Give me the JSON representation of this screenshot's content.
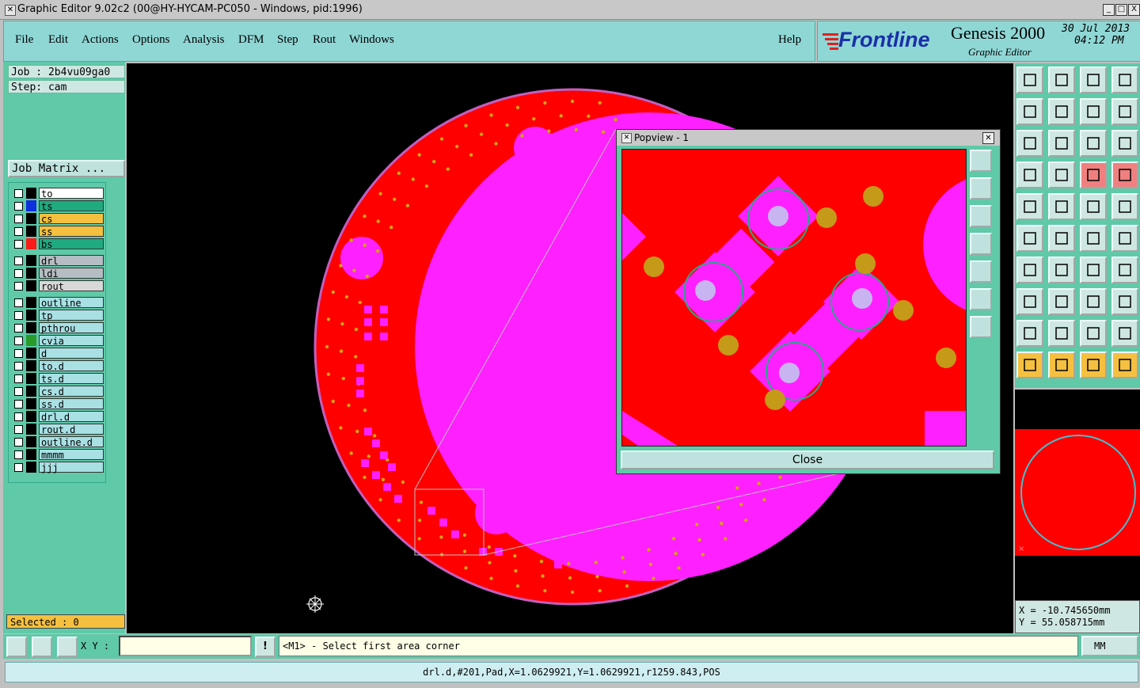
{
  "window": {
    "title": "Graphic Editor 9.02c2 (00@HY-HYCAM-PC050 - Windows, pid:1996)",
    "controls": [
      "_",
      "□",
      "X"
    ]
  },
  "menu": {
    "items": [
      "File",
      "Edit",
      "Actions",
      "Options",
      "Analysis",
      "DFM",
      "Step",
      "Rout",
      "Windows"
    ],
    "help": "Help"
  },
  "brand": {
    "logo": "Frontline",
    "product": "Genesis 2000",
    "subtitle": "Graphic Editor",
    "date": "30 Jul 2013",
    "time": "04:12 PM"
  },
  "job": {
    "job_label": "Job : 2b4vu09ga0",
    "step_label": "Step: cam",
    "matrix_button": "Job Matrix ..."
  },
  "layers": [
    {
      "name": "to",
      "bg": "#ffffff",
      "swatch": "#000000"
    },
    {
      "name": "ts",
      "bg": "#1faa80",
      "swatch": "#1030e0"
    },
    {
      "name": "cs",
      "bg": "#f5c040",
      "swatch": "#000000"
    },
    {
      "name": "ss",
      "bg": "#f5c040",
      "swatch": "#000000"
    },
    {
      "name": "bs",
      "bg": "#1faa80",
      "swatch": "#ff1a1a"
    },
    {
      "name": "drl",
      "bg": "#b5bcc2",
      "swatch": "#000000"
    },
    {
      "name": "ldi",
      "bg": "#b5bcc2",
      "swatch": "#000000"
    },
    {
      "name": "rout",
      "bg": "#d8d8d8",
      "swatch": "#000000"
    },
    {
      "name": "outline",
      "bg": "#a8e0e4",
      "swatch": "#000000"
    },
    {
      "name": "tp",
      "bg": "#a8e0e4",
      "swatch": "#000000"
    },
    {
      "name": "pthrou",
      "bg": "#a8e0e4",
      "swatch": "#000000"
    },
    {
      "name": "cvia",
      "bg": "#a8e0e4",
      "swatch": "#2a9a2a"
    },
    {
      "name": "d",
      "bg": "#a8e0e4",
      "swatch": "#000000"
    },
    {
      "name": "to.d",
      "bg": "#a8e0e4",
      "swatch": "#000000"
    },
    {
      "name": "ts.d",
      "bg": "#a8e0e4",
      "swatch": "#000000"
    },
    {
      "name": "cs.d",
      "bg": "#a8e0e4",
      "swatch": "#000000"
    },
    {
      "name": "ss.d",
      "bg": "#a8e0e4",
      "swatch": "#000000"
    },
    {
      "name": "drl.d",
      "bg": "#a8e0e4",
      "swatch": "#000000"
    },
    {
      "name": "rout.d",
      "bg": "#a8e0e4",
      "swatch": "#000000"
    },
    {
      "name": "outline.d",
      "bg": "#a8e0e4",
      "swatch": "#000000"
    },
    {
      "name": "mmmm",
      "bg": "#a8e0e4",
      "swatch": "#000000"
    },
    {
      "name": "jjj",
      "bg": "#a8e0e4",
      "swatch": "#000000"
    }
  ],
  "selected": "Selected : 0",
  "popview": {
    "title": "Popview - 1",
    "close": "Close"
  },
  "coords": {
    "x": "X = -10.745650mm",
    "y": "Y = 55.058715mm"
  },
  "bottom": {
    "xy_label": "X Y :",
    "xy_value": "",
    "prompt": "<M1> - Select first area corner",
    "units": "MM"
  },
  "status": "drl.d,#201,Pad,X=1.0629921,Y=1.0629921,r1259.843,POS",
  "colors": {
    "board": "#ff0000",
    "pad": "#ff20ff",
    "drill": "#d4a017",
    "panel": "#5fc9a8"
  }
}
